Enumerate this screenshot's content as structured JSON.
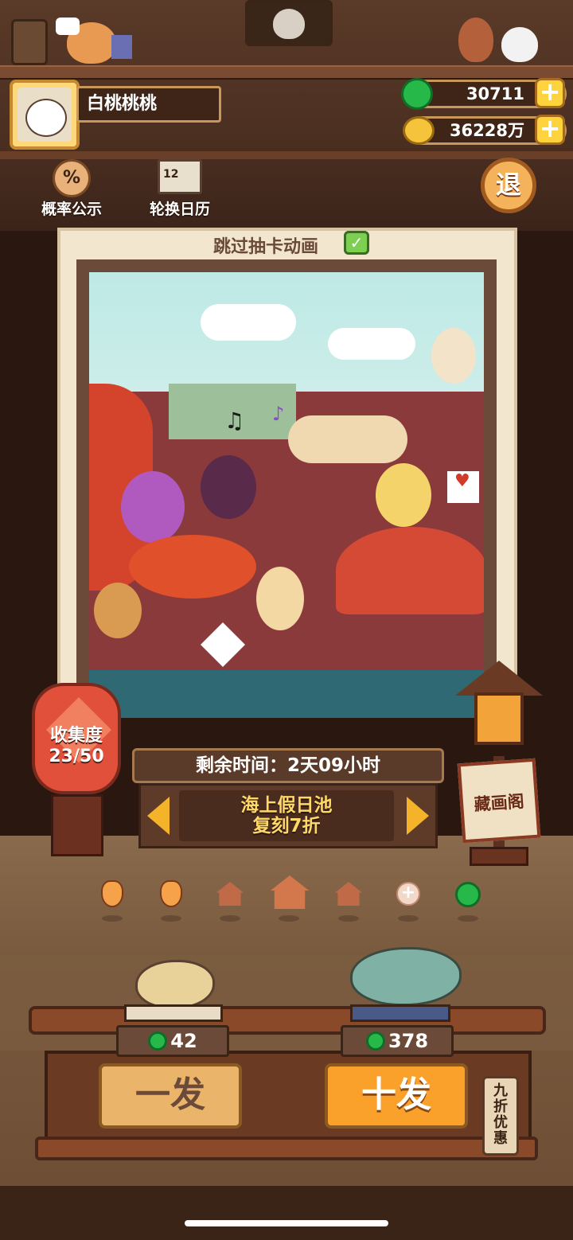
{
  "player": {
    "name": "白桃桃桃"
  },
  "currency": {
    "jade_amount": "30711",
    "coin_amount": "36228万"
  },
  "menu": {
    "probability_label": "概率公示",
    "probability_icon_text": "%",
    "calendar_label": "轮换日历",
    "calendar_icon_text": "12",
    "exit_label": "退"
  },
  "card": {
    "skip_animation_label": "跳过抽卡动画",
    "skip_checked": true
  },
  "collection": {
    "label": "收集度",
    "progress": "23/50"
  },
  "pool": {
    "remaining_time": "剩余时间：2天09小时",
    "name_line1": "海上假日池",
    "name_line2": "复刻7折"
  },
  "gallery": {
    "label": "藏画阁"
  },
  "pagination": {
    "items": [
      "acorn-icon",
      "acorn-icon",
      "house-icon",
      "house-icon-active",
      "house-icon",
      "plus-icon",
      "jade-icon"
    ],
    "active_index": 3
  },
  "pull": {
    "single_cost": "42",
    "ten_cost": "378",
    "single_label": "一发",
    "ten_label": "十发",
    "discount_tag": "九折优惠"
  },
  "colors": {
    "accent_gold": "#f9a12b",
    "jade_green": "#27b84a",
    "wood_dark": "#3e2518"
  }
}
